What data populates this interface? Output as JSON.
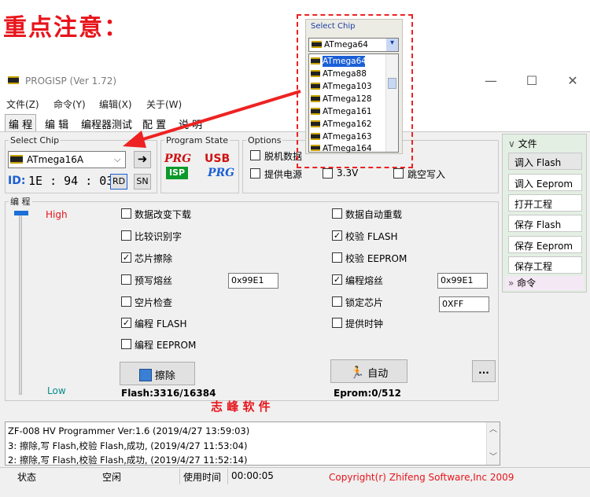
{
  "note_title": "重点注意：",
  "window": {
    "title": "PROGISP (Ver 1.72)",
    "min_icon": "—",
    "max_icon": "☐",
    "close_icon": "✕"
  },
  "menu": [
    "文件(Z)",
    "命令(Y)",
    "编辑(X)",
    "关于(W)"
  ],
  "tabs": [
    "编 程",
    "编 辑",
    "编程器测试",
    "配 置",
    "说 明"
  ],
  "select_chip": {
    "legend": "Select Chip",
    "value": "ATmega16A",
    "id_label": "ID:",
    "id_value": "1E : 94 : 03",
    "rd": "RD",
    "sn": "SN"
  },
  "program_state": {
    "legend": "Program State",
    "prg": "PRG",
    "isp": "ISP",
    "usb": "USB",
    "prg2": "PRG"
  },
  "options": {
    "legend": "Options",
    "items": [
      "脱机数据",
      "提供电源",
      "3.3V",
      "跳空写入"
    ]
  },
  "program": {
    "legend": "编 程",
    "high": "High",
    "low": "Low",
    "left": [
      {
        "label": "数据改变下载",
        "checked": false
      },
      {
        "label": "比较识别字",
        "checked": false
      },
      {
        "label": "芯片擦除",
        "checked": true
      },
      {
        "label": "预写熔丝",
        "checked": false
      },
      {
        "label": "空片检查",
        "checked": false
      },
      {
        "label": "编程 FLASH",
        "checked": true
      },
      {
        "label": "编程 EEPROM",
        "checked": false
      }
    ],
    "right": [
      {
        "label": "数据自动重载",
        "checked": false
      },
      {
        "label": "校验 FLASH",
        "checked": true
      },
      {
        "label": "校验 EEPROM",
        "checked": false
      },
      {
        "label": "编程熔丝",
        "checked": true
      },
      {
        "label": "锁定芯片",
        "checked": false
      },
      {
        "label": "提供时钟",
        "checked": false
      }
    ],
    "fuse_pre": "0x99E1",
    "fuse_prog": "0x99E1",
    "lock": "0XFF",
    "erase_btn": "擦除",
    "auto_btn": "自动",
    "more_btn": "...",
    "flash_info": "Flash:3316/16384",
    "eprom_info": "Eprom:0/512",
    "watermark": "志 峰 软 件"
  },
  "right_panel": {
    "file_header": "文件",
    "buttons": [
      "调入 Flash",
      "调入 Eeprom",
      "打开工程",
      "保存 Flash",
      "保存 Eeprom",
      "保存工程"
    ],
    "cmd_header": "命令"
  },
  "log": [
    "ZF-008 HV Programmer Ver:1.6 (2019/4/27 13:59:03)",
    "3: 擦除,写 Flash,校验 Flash,成功, (2019/4/27 11:53:04)",
    "2: 擦除,写 Flash,校验 Flash,成功, (2019/4/27 11:52:14)"
  ],
  "status": {
    "state_label": "状态",
    "state_value": "空闲",
    "time_label": "使用时间",
    "time_value": "00:00:05",
    "copyright": "Copyright(r) Zhifeng Software,Inc 2009"
  },
  "popup": {
    "legend": "Select Chip",
    "value": "ATmega64",
    "items": [
      "ATmega64",
      "ATmega88",
      "ATmega103",
      "ATmega128",
      "ATmega161",
      "ATmega162",
      "ATmega163",
      "ATmega164"
    ]
  },
  "colors": {
    "red": "#e8141b",
    "blue": "#1a5fd6"
  }
}
